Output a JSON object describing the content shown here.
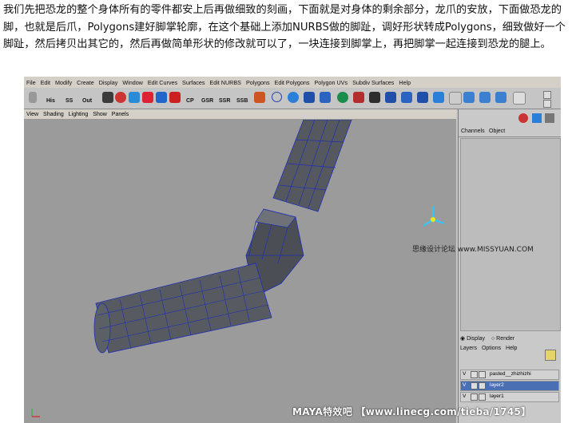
{
  "article": {
    "text": "我们先把恐龙的整个身体所有的零件都安上后再做细致的刻画，下面就是对身体的剩余部分，龙爪的安放，下面做恐龙的脚，也就是后爪，Polygons建好脚掌轮廓，在这个基础上添加NURBS做的脚趾，调好形状转成Polygons，细致做好一个脚趾，然后拷贝出其它的，然后再做简单形状的修改就可以了，一块连接到脚掌上，再把脚掌一起连接到恐龙的腿上。"
  },
  "app": {
    "menu": [
      "File",
      "Edit",
      "Modify",
      "Create",
      "Display",
      "Window",
      "Edit Curves",
      "Surfaces",
      "Edit NURBS",
      "Polygons",
      "Edit Polygons",
      "Polygon UVs",
      "Subdiv Surfaces",
      "Help"
    ],
    "shelf_labels": [
      "His",
      "SS",
      "Out",
      "CP",
      "GSR",
      "SSR",
      "SSB"
    ],
    "viewport_menu": [
      "View",
      "Shading",
      "Lighting",
      "Show",
      "Panels"
    ],
    "right_tabs": [
      "Channels",
      "Object"
    ],
    "display_radio": "Display",
    "render_radio": "Render",
    "layer_menu": [
      "Layers",
      "Options",
      "Help"
    ],
    "layers": [
      {
        "vis": "V",
        "name": "pasted__zhizhizhi",
        "selected": false
      },
      {
        "vis": "V",
        "name": "layer2",
        "selected": true
      },
      {
        "vis": "V",
        "name": "layer1",
        "selected": false
      }
    ]
  },
  "watermark": "思缘设计论坛 www.MISSYUAN.COM",
  "footer": "MAYA特效吧 【www.linecg.com/tieba/1745】",
  "colors": {
    "mesh": "#55595f",
    "edge": "#1e2eb5",
    "viewport": "#9b9b9b",
    "selected_layer": "#4a6fb3"
  }
}
